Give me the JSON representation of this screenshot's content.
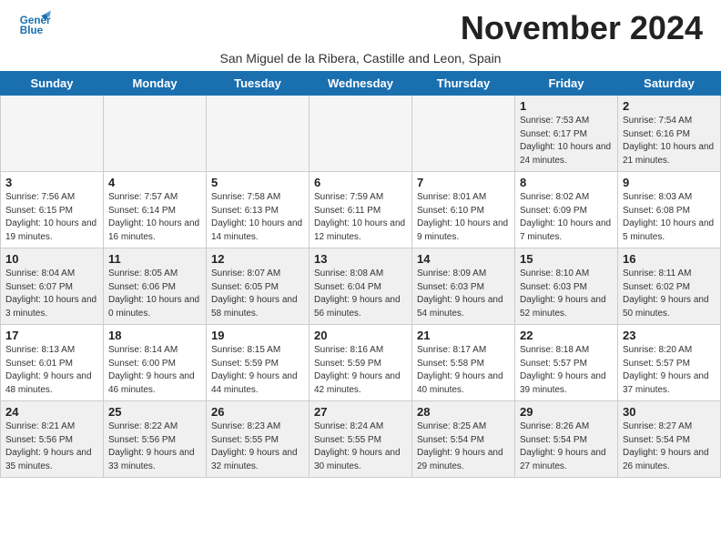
{
  "header": {
    "title": "November 2024",
    "subtitle": "San Miguel de la Ribera, Castille and Leon, Spain",
    "logo_line1": "General",
    "logo_line2": "Blue"
  },
  "weekdays": [
    "Sunday",
    "Monday",
    "Tuesday",
    "Wednesday",
    "Thursday",
    "Friday",
    "Saturday"
  ],
  "weeks": [
    [
      {
        "day": "",
        "empty": true
      },
      {
        "day": "",
        "empty": true
      },
      {
        "day": "",
        "empty": true
      },
      {
        "day": "",
        "empty": true
      },
      {
        "day": "",
        "empty": true
      },
      {
        "day": "1",
        "info": "Sunrise: 7:53 AM\nSunset: 6:17 PM\nDaylight: 10 hours and 24 minutes."
      },
      {
        "day": "2",
        "info": "Sunrise: 7:54 AM\nSunset: 6:16 PM\nDaylight: 10 hours and 21 minutes."
      }
    ],
    [
      {
        "day": "3",
        "info": "Sunrise: 7:56 AM\nSunset: 6:15 PM\nDaylight: 10 hours and 19 minutes."
      },
      {
        "day": "4",
        "info": "Sunrise: 7:57 AM\nSunset: 6:14 PM\nDaylight: 10 hours and 16 minutes."
      },
      {
        "day": "5",
        "info": "Sunrise: 7:58 AM\nSunset: 6:13 PM\nDaylight: 10 hours and 14 minutes."
      },
      {
        "day": "6",
        "info": "Sunrise: 7:59 AM\nSunset: 6:11 PM\nDaylight: 10 hours and 12 minutes."
      },
      {
        "day": "7",
        "info": "Sunrise: 8:01 AM\nSunset: 6:10 PM\nDaylight: 10 hours and 9 minutes."
      },
      {
        "day": "8",
        "info": "Sunrise: 8:02 AM\nSunset: 6:09 PM\nDaylight: 10 hours and 7 minutes."
      },
      {
        "day": "9",
        "info": "Sunrise: 8:03 AM\nSunset: 6:08 PM\nDaylight: 10 hours and 5 minutes."
      }
    ],
    [
      {
        "day": "10",
        "info": "Sunrise: 8:04 AM\nSunset: 6:07 PM\nDaylight: 10 hours and 3 minutes."
      },
      {
        "day": "11",
        "info": "Sunrise: 8:05 AM\nSunset: 6:06 PM\nDaylight: 10 hours and 0 minutes."
      },
      {
        "day": "12",
        "info": "Sunrise: 8:07 AM\nSunset: 6:05 PM\nDaylight: 9 hours and 58 minutes."
      },
      {
        "day": "13",
        "info": "Sunrise: 8:08 AM\nSunset: 6:04 PM\nDaylight: 9 hours and 56 minutes."
      },
      {
        "day": "14",
        "info": "Sunrise: 8:09 AM\nSunset: 6:03 PM\nDaylight: 9 hours and 54 minutes."
      },
      {
        "day": "15",
        "info": "Sunrise: 8:10 AM\nSunset: 6:03 PM\nDaylight: 9 hours and 52 minutes."
      },
      {
        "day": "16",
        "info": "Sunrise: 8:11 AM\nSunset: 6:02 PM\nDaylight: 9 hours and 50 minutes."
      }
    ],
    [
      {
        "day": "17",
        "info": "Sunrise: 8:13 AM\nSunset: 6:01 PM\nDaylight: 9 hours and 48 minutes."
      },
      {
        "day": "18",
        "info": "Sunrise: 8:14 AM\nSunset: 6:00 PM\nDaylight: 9 hours and 46 minutes."
      },
      {
        "day": "19",
        "info": "Sunrise: 8:15 AM\nSunset: 5:59 PM\nDaylight: 9 hours and 44 minutes."
      },
      {
        "day": "20",
        "info": "Sunrise: 8:16 AM\nSunset: 5:59 PM\nDaylight: 9 hours and 42 minutes."
      },
      {
        "day": "21",
        "info": "Sunrise: 8:17 AM\nSunset: 5:58 PM\nDaylight: 9 hours and 40 minutes."
      },
      {
        "day": "22",
        "info": "Sunrise: 8:18 AM\nSunset: 5:57 PM\nDaylight: 9 hours and 39 minutes."
      },
      {
        "day": "23",
        "info": "Sunrise: 8:20 AM\nSunset: 5:57 PM\nDaylight: 9 hours and 37 minutes."
      }
    ],
    [
      {
        "day": "24",
        "info": "Sunrise: 8:21 AM\nSunset: 5:56 PM\nDaylight: 9 hours and 35 minutes."
      },
      {
        "day": "25",
        "info": "Sunrise: 8:22 AM\nSunset: 5:56 PM\nDaylight: 9 hours and 33 minutes."
      },
      {
        "day": "26",
        "info": "Sunrise: 8:23 AM\nSunset: 5:55 PM\nDaylight: 9 hours and 32 minutes."
      },
      {
        "day": "27",
        "info": "Sunrise: 8:24 AM\nSunset: 5:55 PM\nDaylight: 9 hours and 30 minutes."
      },
      {
        "day": "28",
        "info": "Sunrise: 8:25 AM\nSunset: 5:54 PM\nDaylight: 9 hours and 29 minutes."
      },
      {
        "day": "29",
        "info": "Sunrise: 8:26 AM\nSunset: 5:54 PM\nDaylight: 9 hours and 27 minutes."
      },
      {
        "day": "30",
        "info": "Sunrise: 8:27 AM\nSunset: 5:54 PM\nDaylight: 9 hours and 26 minutes."
      }
    ]
  ]
}
